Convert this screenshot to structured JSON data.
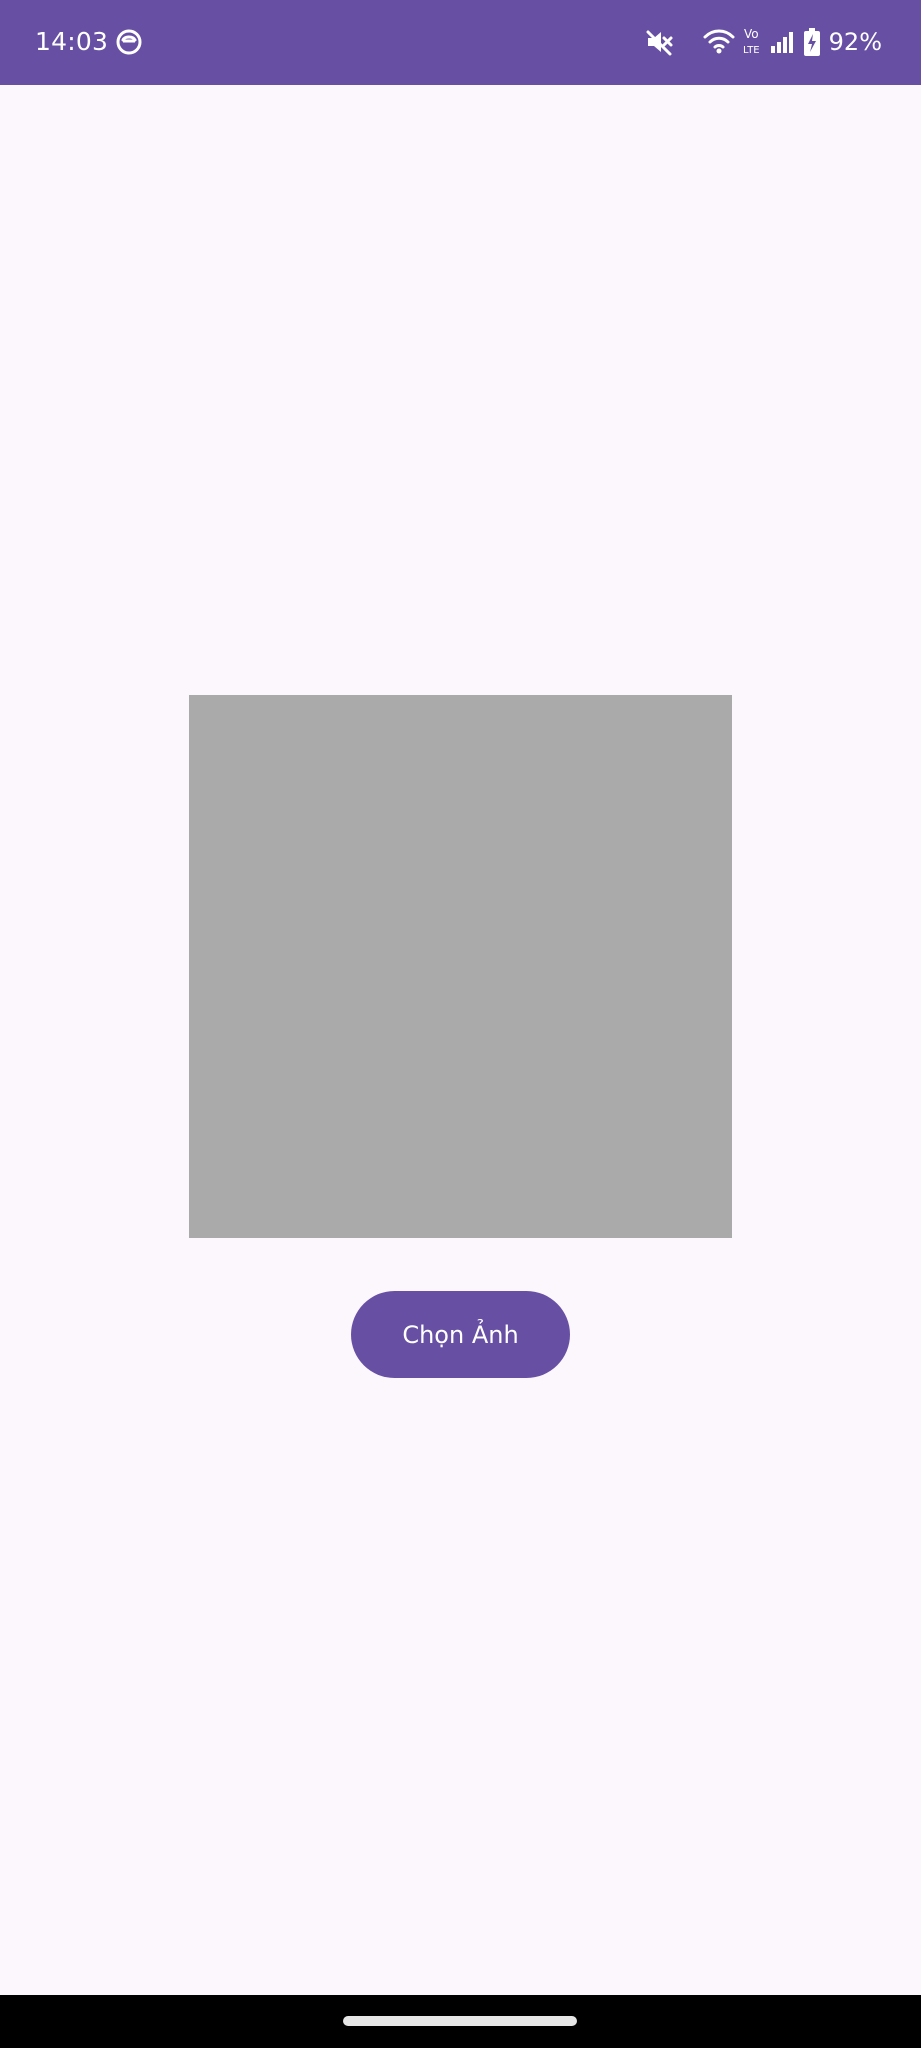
{
  "status_bar": {
    "time": "14:03",
    "battery_percent": "92%",
    "background_color": "#6750a4",
    "icons": [
      "app-notification-icon",
      "mute-icon",
      "wifi-icon",
      "volte-icon",
      "signal-icon",
      "battery-charging-icon"
    ],
    "volte_label_top": "Vo",
    "volte_label_bottom": "LTE"
  },
  "main": {
    "image_placeholder_color": "#aaaaaa",
    "pick_button_label": "Chọn Ảnh",
    "accent_color": "#6750a4",
    "background_color": "#fcf6fd"
  },
  "navigation": {
    "home_handle": "gesture-navigation-handle"
  }
}
